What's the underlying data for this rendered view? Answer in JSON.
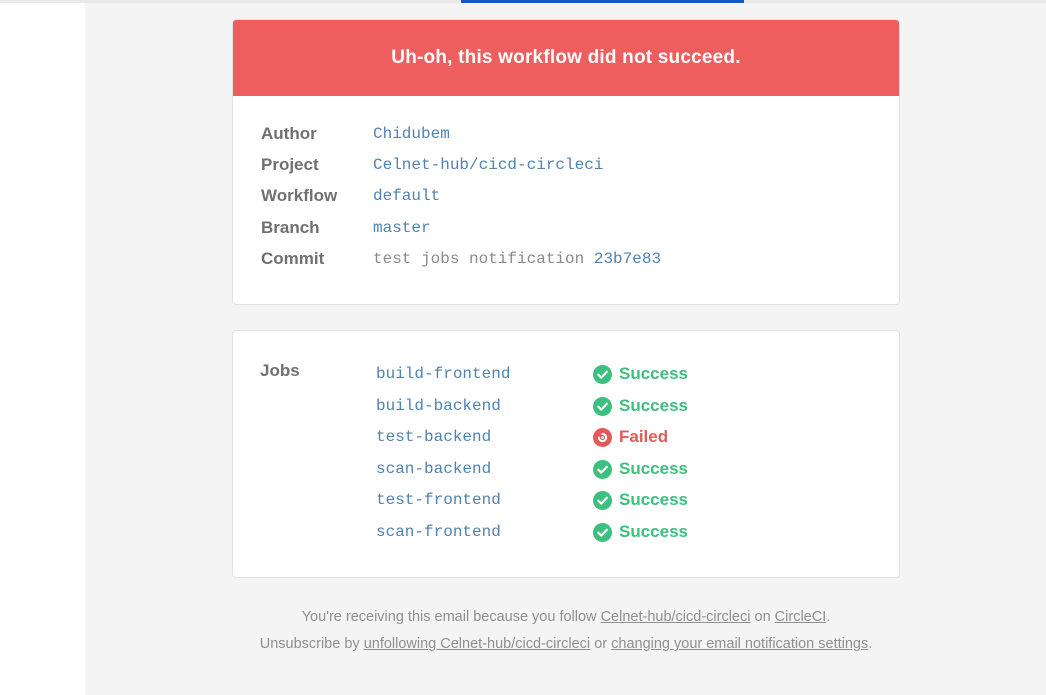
{
  "banner": {
    "title": "Uh-oh, this workflow did not succeed."
  },
  "details": {
    "author": {
      "label": "Author",
      "value": "Chidubem"
    },
    "project": {
      "label": "Project",
      "value": "Celnet-hub/cicd-circleci"
    },
    "workflow": {
      "label": "Workflow",
      "value": "default"
    },
    "branch": {
      "label": "Branch",
      "value": "master"
    },
    "commit": {
      "label": "Commit",
      "message": "test jobs notification",
      "hash": "23b7e83"
    }
  },
  "jobs": {
    "label": "Jobs",
    "items": [
      {
        "name": "build-frontend",
        "status": "Success"
      },
      {
        "name": "build-backend",
        "status": "Success"
      },
      {
        "name": "test-backend",
        "status": "Failed"
      },
      {
        "name": "scan-backend",
        "status": "Success"
      },
      {
        "name": "test-frontend",
        "status": "Success"
      },
      {
        "name": "scan-frontend",
        "status": "Success"
      }
    ]
  },
  "footer": {
    "line1_prefix": "You're receiving this email because you follow",
    "project_link": "Celnet-hub/cicd-circleci",
    "line1_on": "on",
    "circleci_link": "CircleCI",
    "line1_end": ".",
    "line2_prefix": "Unsubscribe by",
    "unfollow_link": "unfollowing Celnet-hub/cicd-circleci",
    "line2_or": "or",
    "settings_link": "changing your email notification settings",
    "line2_end": "."
  },
  "colors": {
    "banner": "#ef5e5e",
    "success": "#3dbf7d",
    "failed": "#e15b5b",
    "link": "#4f83b4",
    "tab_indicator": "#1a56c8"
  },
  "icons": {
    "success": "check-circle-icon",
    "failed": "failed-circle-icon"
  }
}
